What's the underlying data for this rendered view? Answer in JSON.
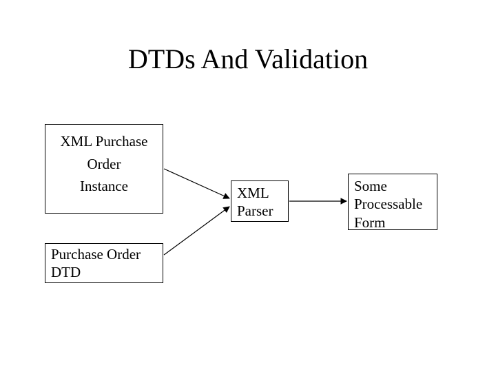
{
  "title": "DTDs And Validation",
  "boxes": {
    "instance": {
      "line1": "XML Purchase",
      "line2": "Order",
      "line3": "Instance"
    },
    "parser": {
      "line1": "XML",
      "line2": "Parser"
    },
    "form": {
      "line1": "Some",
      "line2": "Processable",
      "line3": "Form"
    },
    "dtd": {
      "line1": "Purchase Order",
      "line2": "DTD"
    }
  }
}
